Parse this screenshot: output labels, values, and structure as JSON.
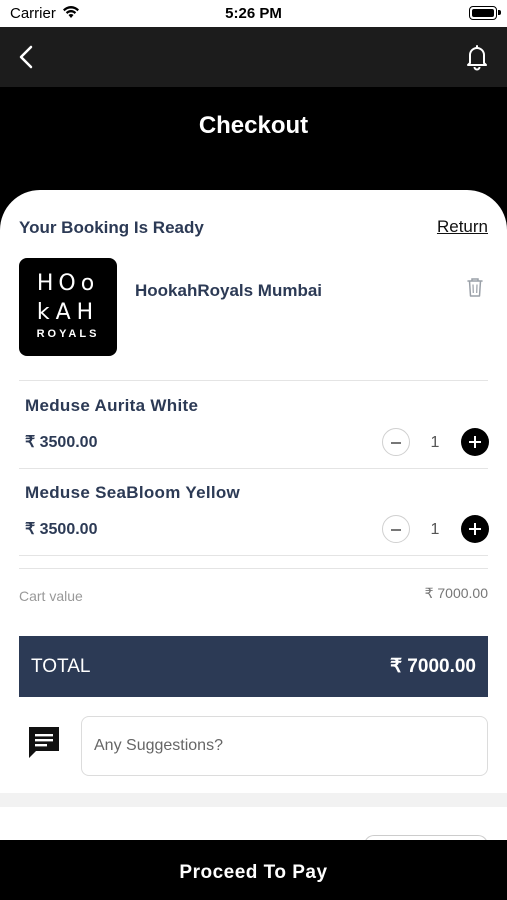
{
  "status_bar": {
    "carrier": "Carrier",
    "time": "5:26 PM"
  },
  "nav": {
    "back_icon": "chevron-left-icon",
    "notification_icon": "bell-icon"
  },
  "page_title": "Checkout",
  "booking": {
    "title": "Your Booking Is Ready",
    "return_label": "Return"
  },
  "venue": {
    "logo_line1": "HOo",
    "logo_line2": "kAH",
    "logo_line3": "ROYALS",
    "name": "HookahRoyals Mumbai",
    "delete_icon": "trash-icon"
  },
  "items": [
    {
      "name": "Meduse Aurita White",
      "price": "₹ 3500.00",
      "quantity": "1"
    },
    {
      "name": "Meduse SeaBloom Yellow",
      "price": "₹ 3500.00",
      "quantity": "1"
    }
  ],
  "summary": {
    "cart_label": "Cart value",
    "cart_value": "₹ 7000.00",
    "total_label": "TOTAL",
    "total_value": "₹ 7000.00"
  },
  "suggestions": {
    "icon": "chat-icon",
    "placeholder": "Any Suggestions?"
  },
  "footer": {
    "pay_label": "Proceed To Pay"
  },
  "colors": {
    "accent": "#2c3a55",
    "header": "#000000",
    "nav": "#1c1c1c"
  }
}
